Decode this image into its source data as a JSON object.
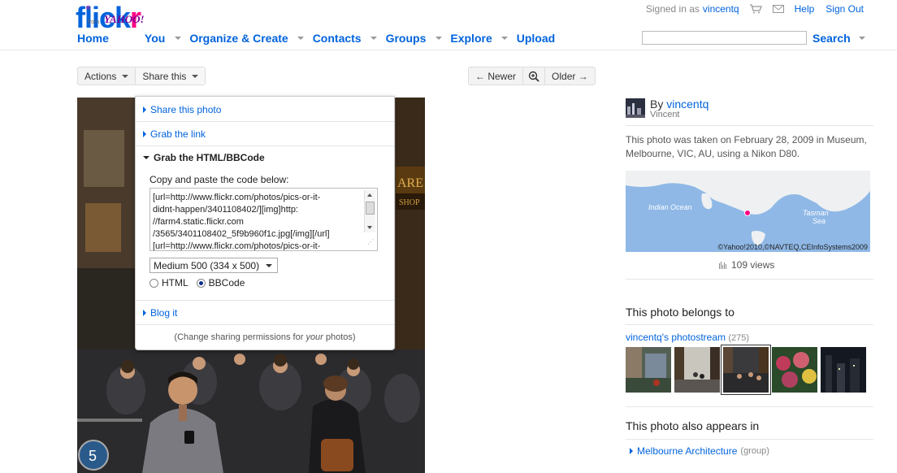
{
  "logo": {
    "word_blue": "flick",
    "word_pink": "r",
    "reg": "®",
    "from": "from",
    "yahoo": "YAHOO!"
  },
  "topbar": {
    "signed_in_as": "Signed in as",
    "username": "vincentq",
    "cart_icon": "cart-icon",
    "mail_icon": "mail-icon",
    "help": "Help",
    "sign_out": "Sign Out"
  },
  "nav": {
    "items": [
      {
        "label": "Home",
        "has_dropdown": false
      },
      {
        "label": "You",
        "has_dropdown": true
      },
      {
        "label": "Organize & Create",
        "has_dropdown": true
      },
      {
        "label": "Contacts",
        "has_dropdown": true
      },
      {
        "label": "Groups",
        "has_dropdown": true
      },
      {
        "label": "Explore",
        "has_dropdown": true
      },
      {
        "label": "Upload",
        "has_dropdown": false
      }
    ],
    "search_value": "",
    "search_label": "Search"
  },
  "toolbar": {
    "actions": "Actions",
    "share_this": "Share this",
    "newer": "← Newer",
    "zoom_icon": "zoom-icon",
    "older": "Older →"
  },
  "share_popup": {
    "share_photo": "Share this photo",
    "grab_link": "Grab the link",
    "grab_html": "Grab the HTML/BBCode",
    "copy_instruction": "Copy and paste the code below:",
    "code_lines": [
      "[url=http://www.flickr.com/photos/pics-or-it-",
      "didnt-happen/3401108402/][img]http:",
      "//farm4.static.flickr.com",
      "/3565/3401108402_5f9b960f1c.jpg[/img][/url]",
      "[url=http://www.flickr.com/photos/pics-or-it-"
    ],
    "size_selected": "Medium 500 (334 x 500)",
    "format_html": "HTML",
    "format_bbcode": "BBCode",
    "format_selected": "BBCode",
    "blog_it": "Blog it",
    "footer_pre": "(Change sharing permissions for ",
    "footer_em": "your",
    "footer_post": " photos)"
  },
  "sidebar": {
    "by": "By",
    "owner": "vincentq",
    "owner_realname": "Vincent",
    "taken_text": "This photo was taken on February 28, 2009 in Museum, Melbourne, VIC, AU, using a Nikon D80.",
    "map": {
      "label_indian": "Indian Ocean",
      "label_tasman_1": "Tasman",
      "label_tasman_2": "Sea",
      "credit": "©Yahoo!2010,©NAVTEQ,CEInfoSystems2009"
    },
    "views": "109 views",
    "belongs_title": "This photo belongs to",
    "photostream": "vincentq's photostream",
    "photostream_count": "(275)",
    "appears_title": "This photo also appears in",
    "set_name": "Melbourne Architecture",
    "set_type": "(group)"
  },
  "colors": {
    "link": "#0063dc",
    "pink": "#ff0084",
    "map_water": "#8fb8e6"
  }
}
